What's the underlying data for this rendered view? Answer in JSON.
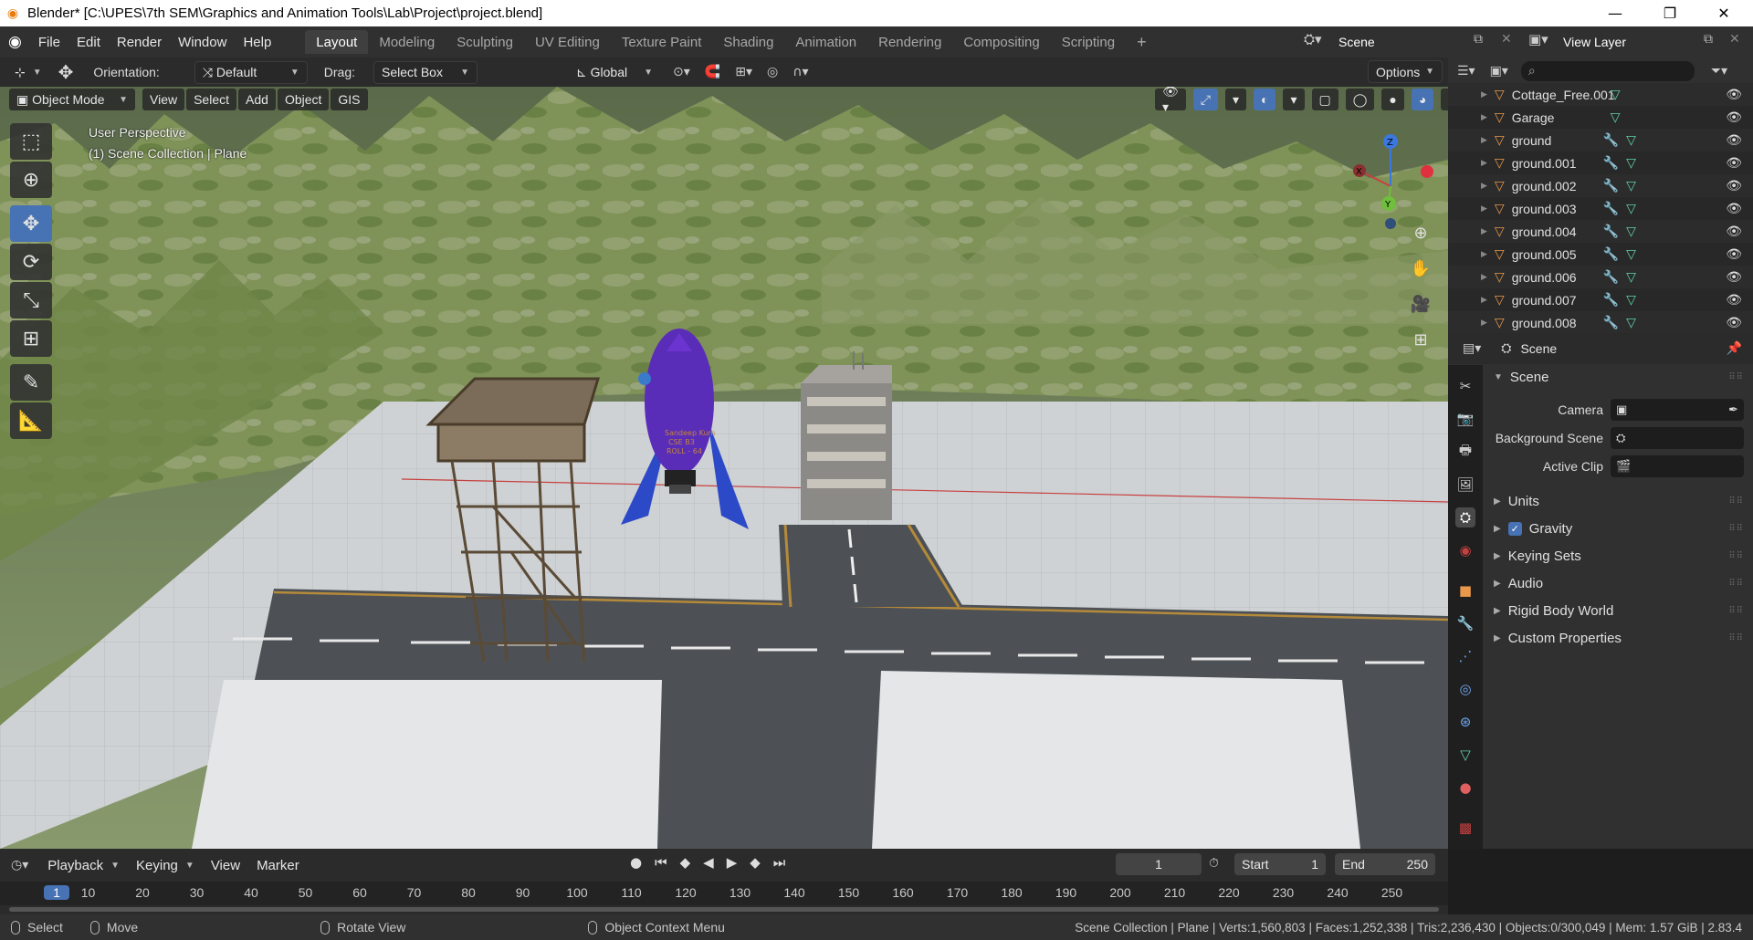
{
  "titlebar": {
    "title": "Blender* [C:\\UPES\\7th SEM\\Graphics and Animation Tools\\Lab\\Project\\project.blend]",
    "minimize": "—",
    "restore": "❐",
    "close": "✕"
  },
  "topbar": {
    "menus": [
      "File",
      "Edit",
      "Render",
      "Window",
      "Help"
    ],
    "workspaces": [
      "Layout",
      "Modeling",
      "Sculpting",
      "UV Editing",
      "Texture Paint",
      "Shading",
      "Animation",
      "Rendering",
      "Compositing",
      "Scripting"
    ],
    "active_workspace": "Layout",
    "add_tab": "+",
    "scene": "Scene",
    "view_layer": "View Layer"
  },
  "header": {
    "orientation_label": "Orientation:",
    "orientation_value": "Default",
    "drag_label": "Drag:",
    "drag_value": "Select Box",
    "transform_orientation": "Global",
    "options": "Options"
  },
  "viewport_header": {
    "mode": "Object Mode",
    "menus": [
      "View",
      "Select",
      "Add",
      "Object",
      "GIS"
    ]
  },
  "viewport": {
    "perspective": "User Perspective",
    "collection": "(1) Scene Collection | Plane",
    "rocket_text": [
      "Sandeep Kum",
      "CSE B3",
      "ROLL - 64"
    ],
    "gizmo_axes": {
      "x": "X",
      "y": "Y",
      "z": "Z"
    }
  },
  "outliner": {
    "items": [
      {
        "name": "Cottage_Free.001",
        "modifier": false
      },
      {
        "name": "Garage",
        "modifier": false
      },
      {
        "name": "ground",
        "modifier": true
      },
      {
        "name": "ground.001",
        "modifier": true
      },
      {
        "name": "ground.002",
        "modifier": true
      },
      {
        "name": "ground.003",
        "modifier": true
      },
      {
        "name": "ground.004",
        "modifier": true
      },
      {
        "name": "ground.005",
        "modifier": true
      },
      {
        "name": "ground.006",
        "modifier": true
      },
      {
        "name": "ground.007",
        "modifier": true
      },
      {
        "name": "ground.008",
        "modifier": true
      }
    ]
  },
  "properties": {
    "context": "Scene",
    "panel": "Scene",
    "fields": [
      {
        "label": "Camera"
      },
      {
        "label": "Background Scene"
      },
      {
        "label": "Active Clip"
      }
    ],
    "sections": [
      "Units",
      "Gravity",
      "Keying Sets",
      "Audio",
      "Rigid Body World",
      "Custom Properties"
    ],
    "gravity_checked": true
  },
  "timeline": {
    "menus": [
      "Playback",
      "Keying",
      "View",
      "Marker"
    ],
    "current_frame": "1",
    "start_label": "Start",
    "start": "1",
    "end_label": "End",
    "end": "250",
    "ticks": [
      "1",
      "10",
      "20",
      "30",
      "40",
      "50",
      "60",
      "70",
      "80",
      "90",
      "100",
      "110",
      "120",
      "130",
      "140",
      "150",
      "160",
      "170",
      "180",
      "190",
      "200",
      "210",
      "220",
      "230",
      "240",
      "250"
    ]
  },
  "statusbar": {
    "select": "Select",
    "move": "Move",
    "rotate": "Rotate View",
    "context_menu": "Object Context Menu",
    "stats": "Scene Collection | Plane | Verts:1,560,803 | Faces:1,252,338 | Tris:2,236,430 | Objects:0/300,049 | Mem: 1.57 GiB | 2.83.4"
  },
  "colors": {
    "accent": "#4772b3",
    "mesh_icon": "#e8984a",
    "data_icon": "#5fd3a8",
    "modifier_icon": "#6fa8f0"
  }
}
